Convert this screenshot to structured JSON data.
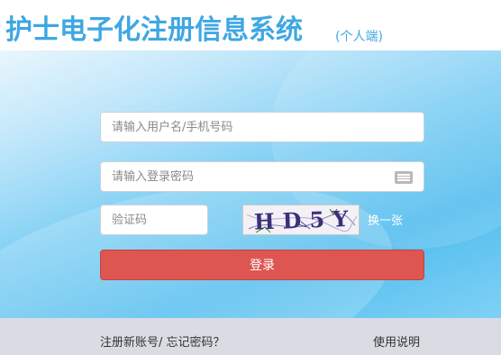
{
  "header": {
    "title": "护士电子化注册信息系统",
    "subtitle": "(个人端)"
  },
  "form": {
    "username_placeholder": "请输入用户名/手机号码",
    "password_placeholder": "请输入登录密码",
    "captcha_placeholder": "验证码",
    "captcha_text": "HD5Y",
    "refresh_captcha_label": "换一张",
    "login_label": "登录"
  },
  "footer": {
    "register_label": "注册新账号/",
    "forgot_password_label": " 忘记密码？",
    "help_label": "使用说明"
  },
  "colors": {
    "brand": "#3fa7e3",
    "login_button": "#dd5651",
    "footer_bg": "#d9dde3"
  },
  "icons": {
    "password_field_icon": "keyboard-icon"
  }
}
